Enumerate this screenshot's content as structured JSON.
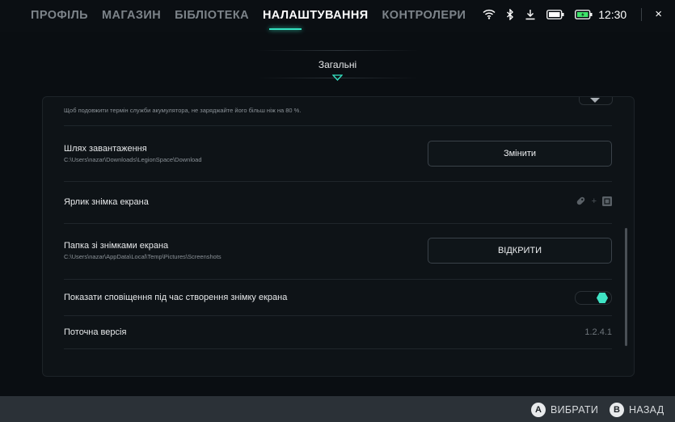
{
  "nav": {
    "items": [
      "ПРОФІЛЬ",
      "МАГАЗИН",
      "БІБЛІОТЕКА",
      "НАЛАШТУВАННЯ",
      "КОНТРОЛЕРИ"
    ],
    "active_index": 3
  },
  "status": {
    "icons": [
      "wifi-icon",
      "bluetooth-icon",
      "download-icon",
      "battery-icon",
      "battery-charging-icon"
    ],
    "time": "12:30",
    "close_glyph": "×"
  },
  "subtab": {
    "label": "Загальні"
  },
  "settings": {
    "battery_note": "Щоб подовжити термін служби акумулятора, не заряджайте його більш ніж на 80 %.",
    "download_path": {
      "title": "Шлях завантаження",
      "value": "C:\\Users\\nazar\\Downloads\\LegionSpace\\Download",
      "button": "Змінити"
    },
    "screenshot_shortcut": {
      "title": "Ярлик знімка екрана",
      "icons": [
        "legion-r-icon",
        "plus-icon",
        "button-glyph-icon"
      ],
      "plus": "+"
    },
    "screenshot_folder": {
      "title": "Папка зі знімками екрана",
      "value": "C:\\Users\\nazar\\AppData\\Local\\Temp\\Pictures\\Screenshots",
      "button": "ВІДКРИТИ"
    },
    "screenshot_notification": {
      "title": "Показати сповіщення під час створення знімку екрана",
      "enabled": true
    },
    "current_version": {
      "title": "Поточна версія",
      "value": "1.2.4.1"
    }
  },
  "footer": {
    "select": {
      "key": "A",
      "label": "ВИБРАТИ"
    },
    "back": {
      "key": "B",
      "label": "НАЗАД"
    }
  },
  "colors": {
    "accent": "#35e3c2",
    "background": "#0a0e12",
    "bottom_bar": "#2b3137"
  }
}
